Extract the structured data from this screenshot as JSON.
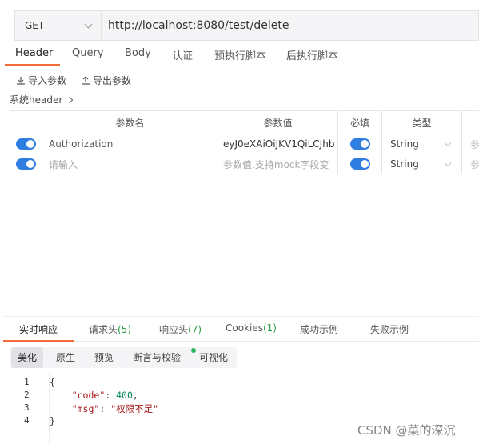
{
  "request": {
    "method": "GET",
    "url": "http://localhost:8080/test/delete"
  },
  "tabs": [
    "Header",
    "Query",
    "Body",
    "认证",
    "预执行脚本",
    "后执行脚本"
  ],
  "toolbar": {
    "import_label": "导入参数",
    "export_label": "导出参数"
  },
  "system_header_label": "系统header",
  "table": {
    "columns": [
      "参数名",
      "参数值",
      "必填",
      "类型"
    ],
    "rows": [
      {
        "enabled": true,
        "name": "Authorization",
        "value": "eyJ0eXAiOiJKV1QiLCJhb",
        "required": true,
        "type": "String",
        "desc": "参"
      },
      {
        "enabled": true,
        "name": "请输入",
        "value": "参数值,支持mock字段变",
        "required": true,
        "type": "String",
        "desc": "参"
      }
    ]
  },
  "response_tabs": [
    {
      "label": "实时响应",
      "count": ""
    },
    {
      "label": "请求头",
      "count": "(5)"
    },
    {
      "label": "响应头",
      "count": "(7)"
    },
    {
      "label": "Cookies",
      "count": "(1)"
    },
    {
      "label": "成功示例",
      "count": ""
    },
    {
      "label": "失败示例",
      "count": ""
    }
  ],
  "view_tabs": [
    "美化",
    "原生",
    "预览",
    "断言与校验",
    "可视化"
  ],
  "code_lines": {
    "l1": "{",
    "l2_key": "\"code\"",
    "l2_val": "400",
    "l3_key": "\"msg\"",
    "l3_val": "\"权限不足\"",
    "l4": "}"
  },
  "line_numbers": [
    "1",
    "2",
    "3",
    "4"
  ],
  "watermark": "CSDN @菜的深沉",
  "colors": {
    "accent": "#f26b3a",
    "toggle": "#2f7de1",
    "count": "#2a9d48"
  }
}
